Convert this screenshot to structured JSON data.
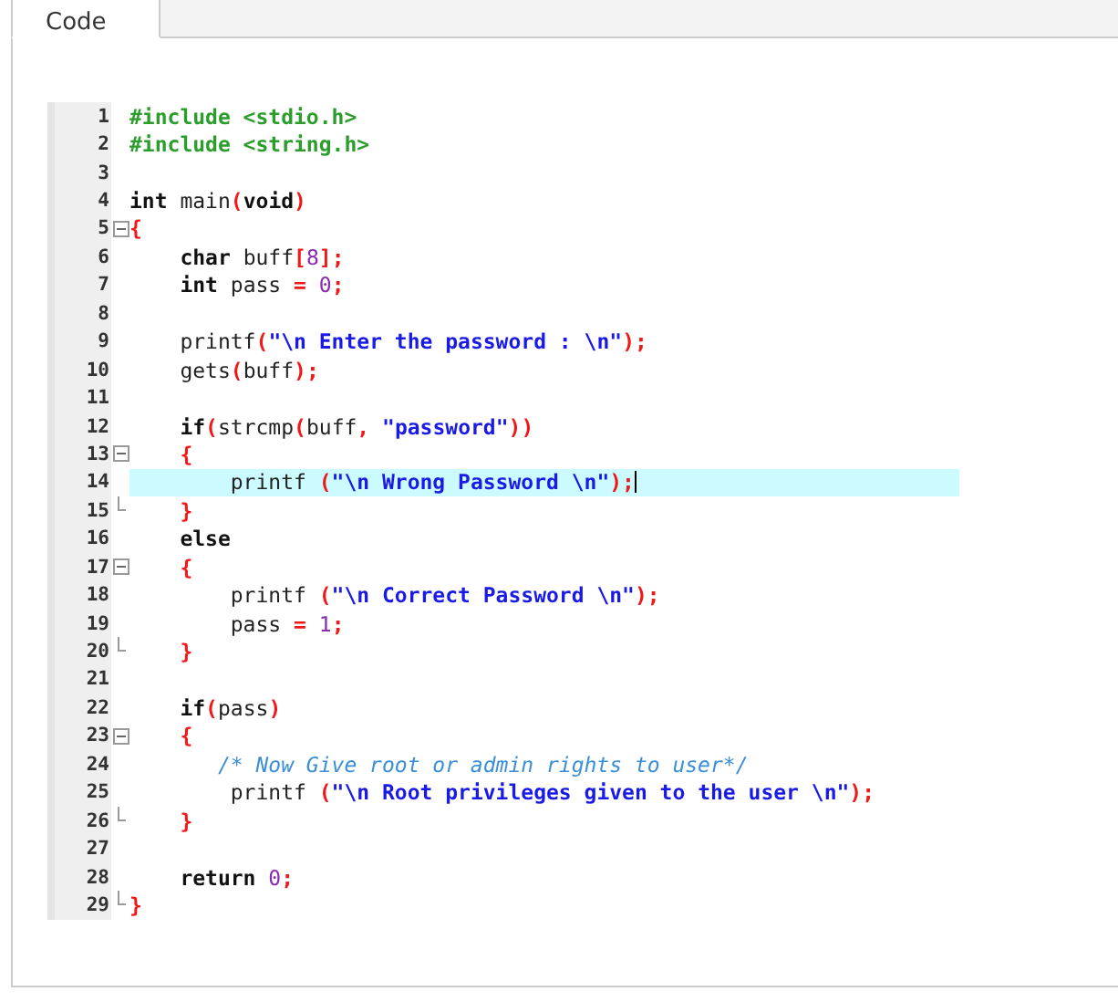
{
  "tabs": [
    {
      "label": "Code",
      "selected": true
    }
  ],
  "editor": {
    "lines": [
      {
        "number": "1",
        "tokens": [
          {
            "kind": "preprocessor",
            "text": "#include <stdio.h>"
          }
        ]
      },
      {
        "number": "2",
        "tokens": [
          {
            "kind": "preprocessor",
            "text": "#include <string.h>"
          }
        ]
      },
      {
        "number": "3"
      },
      {
        "number": "4",
        "tokens": [
          {
            "kind": "keyword",
            "text": "int"
          },
          {
            "kind": "plain",
            "text": " main"
          },
          {
            "kind": "punctuation",
            "text": "("
          },
          {
            "kind": "keyword",
            "text": "void"
          },
          {
            "kind": "punctuation",
            "text": ")"
          }
        ]
      },
      {
        "number": "5",
        "fold_start": true,
        "tokens": [
          {
            "kind": "punctuation",
            "text": "{"
          }
        ]
      },
      {
        "number": "6",
        "tokens": [
          {
            "kind": "keyword",
            "text": "    char"
          },
          {
            "kind": "plain",
            "text": " buff"
          },
          {
            "kind": "punctuation",
            "text": "["
          },
          {
            "kind": "number",
            "text": "8"
          },
          {
            "kind": "punctuation",
            "text": "];"
          }
        ]
      },
      {
        "number": "7",
        "tokens": [
          {
            "kind": "keyword",
            "text": "    int"
          },
          {
            "kind": "plain",
            "text": " pass "
          },
          {
            "kind": "punctuation",
            "text": "="
          },
          {
            "kind": "number",
            "text": " 0"
          },
          {
            "kind": "punctuation",
            "text": ";"
          }
        ]
      },
      {
        "number": "8"
      },
      {
        "number": "9",
        "tokens": [
          {
            "kind": "plain",
            "text": "    printf"
          },
          {
            "kind": "punctuation",
            "text": "("
          },
          {
            "kind": "string",
            "text": "\"\\n Enter the password : \\n\""
          },
          {
            "kind": "punctuation",
            "text": ");"
          }
        ]
      },
      {
        "number": "10",
        "tokens": [
          {
            "kind": "plain",
            "text": "    gets"
          },
          {
            "kind": "punctuation",
            "text": "("
          },
          {
            "kind": "plain",
            "text": "buff"
          },
          {
            "kind": "punctuation",
            "text": ");"
          }
        ]
      },
      {
        "number": "11"
      },
      {
        "number": "12",
        "tokens": [
          {
            "kind": "keyword",
            "text": "    if"
          },
          {
            "kind": "punctuation",
            "text": "("
          },
          {
            "kind": "plain",
            "text": "strcmp"
          },
          {
            "kind": "punctuation",
            "text": "("
          },
          {
            "kind": "plain",
            "text": "buff"
          },
          {
            "kind": "punctuation",
            "text": ","
          },
          {
            "kind": "string",
            "text": " \"password\""
          },
          {
            "kind": "punctuation",
            "text": "))"
          }
        ]
      },
      {
        "number": "13",
        "fold_start": true,
        "tokens": [
          {
            "kind": "punctuation",
            "text": "    {"
          }
        ]
      },
      {
        "number": "14",
        "current": true,
        "tokens": [
          {
            "kind": "plain",
            "text": "        printf "
          },
          {
            "kind": "punctuation",
            "text": "("
          },
          {
            "kind": "string",
            "text": "\"\\n Wrong Password \\n\""
          },
          {
            "kind": "punctuation",
            "text": ");"
          }
        ]
      },
      {
        "number": "15",
        "fold_end": true,
        "tokens": [
          {
            "kind": "punctuation",
            "text": "    }"
          }
        ]
      },
      {
        "number": "16",
        "tokens": [
          {
            "kind": "keyword",
            "text": "    else"
          }
        ]
      },
      {
        "number": "17",
        "fold_start": true,
        "tokens": [
          {
            "kind": "punctuation",
            "text": "    {"
          }
        ]
      },
      {
        "number": "18",
        "tokens": [
          {
            "kind": "plain",
            "text": "        printf "
          },
          {
            "kind": "punctuation",
            "text": "("
          },
          {
            "kind": "string",
            "text": "\"\\n Correct Password \\n\""
          },
          {
            "kind": "punctuation",
            "text": ");"
          }
        ]
      },
      {
        "number": "19",
        "tokens": [
          {
            "kind": "plain",
            "text": "        pass "
          },
          {
            "kind": "punctuation",
            "text": "="
          },
          {
            "kind": "number",
            "text": " 1"
          },
          {
            "kind": "punctuation",
            "text": ";"
          }
        ]
      },
      {
        "number": "20",
        "fold_end": true,
        "tokens": [
          {
            "kind": "punctuation",
            "text": "    }"
          }
        ]
      },
      {
        "number": "21"
      },
      {
        "number": "22",
        "tokens": [
          {
            "kind": "keyword",
            "text": "    if"
          },
          {
            "kind": "punctuation",
            "text": "("
          },
          {
            "kind": "plain",
            "text": "pass"
          },
          {
            "kind": "punctuation",
            "text": ")"
          }
        ]
      },
      {
        "number": "23",
        "fold_start": true,
        "tokens": [
          {
            "kind": "punctuation",
            "text": "    {"
          }
        ]
      },
      {
        "number": "24",
        "tokens": [
          {
            "kind": "comment",
            "text": "       /* Now Give root or admin rights to user*/"
          }
        ]
      },
      {
        "number": "25",
        "tokens": [
          {
            "kind": "plain",
            "text": "        printf "
          },
          {
            "kind": "punctuation",
            "text": "("
          },
          {
            "kind": "string",
            "text": "\"\\n Root privileges given to the user \\n\""
          },
          {
            "kind": "punctuation",
            "text": ");"
          }
        ]
      },
      {
        "number": "26",
        "fold_end": true,
        "tokens": [
          {
            "kind": "punctuation",
            "text": "    }"
          }
        ]
      },
      {
        "number": "27"
      },
      {
        "number": "28",
        "tokens": [
          {
            "kind": "keyword",
            "text": "    return"
          },
          {
            "kind": "number",
            "text": " 0"
          },
          {
            "kind": "punctuation",
            "text": ";"
          }
        ]
      },
      {
        "number": "29",
        "fold_end": true,
        "tokens": [
          {
            "kind": "punctuation",
            "text": "}"
          }
        ]
      }
    ]
  }
}
